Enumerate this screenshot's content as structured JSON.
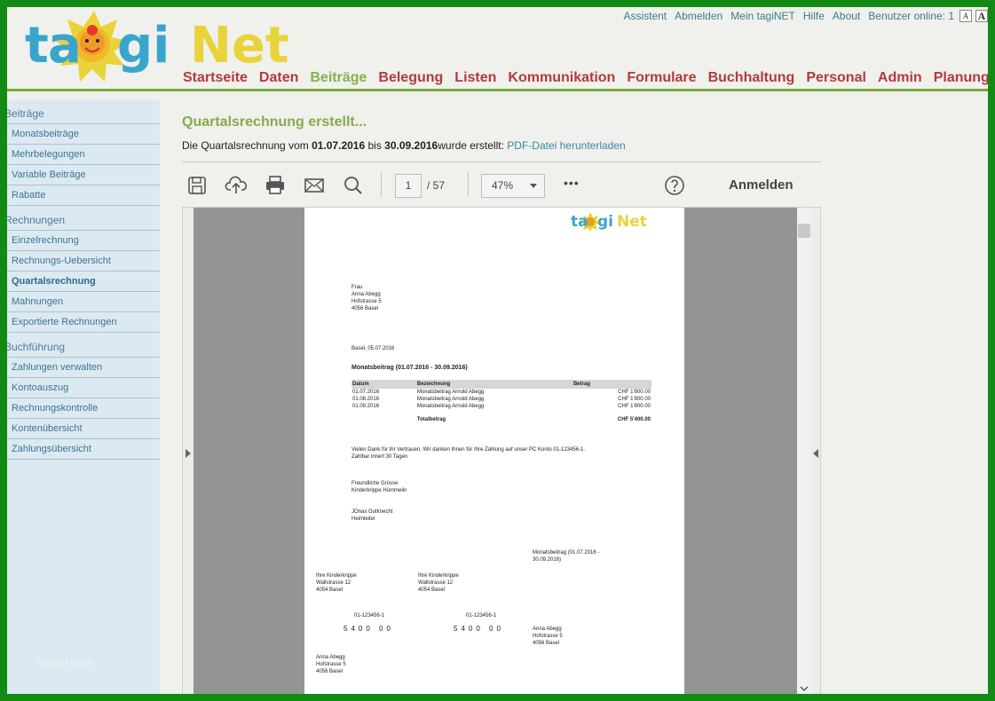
{
  "header": {
    "logo_text": "tagiNet",
    "top_links": [
      "Assistent",
      "Abmelden",
      "Mein tagiNET",
      "Hilfe",
      "About"
    ],
    "online_label": "Benutzer online: 1",
    "font_small": "A",
    "font_big": "A"
  },
  "nav": {
    "items": [
      "Startseite",
      "Daten",
      "Beiträge",
      "Belegung",
      "Listen",
      "Kommunikation",
      "Formulare",
      "Buchhaltung",
      "Personal",
      "Admin",
      "Planung"
    ],
    "active": "Beiträge"
  },
  "sidebar": {
    "groups": [
      {
        "title": "Beiträge",
        "items": [
          "Monatsbeiträge",
          "Mehrbelegungen",
          "Variable Beiträge",
          "Rabatte"
        ]
      },
      {
        "title": "Rechnungen",
        "items": [
          "Einzelrechnung",
          "Rechnungs-Uebersicht",
          "Quartalsrechnung",
          "Mahnungen",
          "Exportierte Rechnungen"
        ]
      },
      {
        "title": "Buchführung",
        "items": [
          "Zahlungen verwalten",
          "Kontoauszug",
          "Rechnungskontrolle",
          "Kontenübersicht",
          "Zahlungsübersicht"
        ]
      }
    ],
    "active_item": "Quartalsrechnung",
    "footer": "Vortag / Ideen"
  },
  "content": {
    "title": "Quartalsrechnung erstellt...",
    "msg_prefix": "Die Quartalsrechnung vom",
    "date_from": "01.07.2016",
    "msg_mid": "bis",
    "date_to": "30.09.2016",
    "msg_suffix": "wurde erstellt:",
    "download_link": "PDF-Datei herunterladen"
  },
  "toolbar": {
    "page_current": "1",
    "page_total": "/ 57",
    "zoom": "47%",
    "more": "•••",
    "signin": "Anmelden"
  },
  "pdf": {
    "logo_text": "tagiNet",
    "recipient": [
      "Frau",
      "Anna Abegg",
      "Hofstrasse 5",
      "4056 Basel"
    ],
    "date_line": "Basel, 05.07.2016",
    "subject": "Monatsbeitrag (01.07.2016 - 30.09.2016)",
    "table": {
      "headers": [
        "Datum",
        "Bezeichnung",
        "Betrag"
      ],
      "rows": [
        [
          "01.07.2016",
          "Monatsbeitrag Arnold Abegg",
          "CHF 1'800.00"
        ],
        [
          "01.08.2016",
          "Monatsbeitrag Arnold Abegg",
          "CHF 1'800.00"
        ],
        [
          "01.09.2016",
          "Monatsbeitrag Arnold Abegg",
          "CHF 1'800.00"
        ]
      ],
      "total_label": "Totalbetrag",
      "total_value": "CHF 5'400.00"
    },
    "thanks": "Vielen Dank für Ihr Vertrauen. Wir danken Ihnen für Ihre Zahlung auf unser PC Konto 01-123456-1.",
    "terms": "Zahlbar innert 30 Tagen",
    "greeting": [
      "Freundliche Grüsse",
      "Kinderkrippe Hümmelin"
    ],
    "signer": [
      "JOnas Gutknecht",
      "Heimleiter"
    ],
    "slip_ref": [
      "Monatsbeitrag (01.07.2016 -",
      "30.09.2016)"
    ],
    "slip_addr_a": [
      "Ihre Kinderkrippe",
      "Wallstrasse 12",
      "4054 Basel"
    ],
    "slip_addr_b": [
      "Ihre Kinderkrippe",
      "Wallstrasse 12",
      "4054 Basel"
    ],
    "account_a": "01-123456-1",
    "account_b": "01-123456-1",
    "amount_a": "5400 00",
    "amount_b": "5400 00",
    "payer_right": [
      "Anna Abegg",
      "Hofstrasse 5",
      "4056 Basel"
    ],
    "payer_left": [
      "Anna Abegg",
      "Hofstrasse 5",
      "4056 Basel"
    ]
  }
}
